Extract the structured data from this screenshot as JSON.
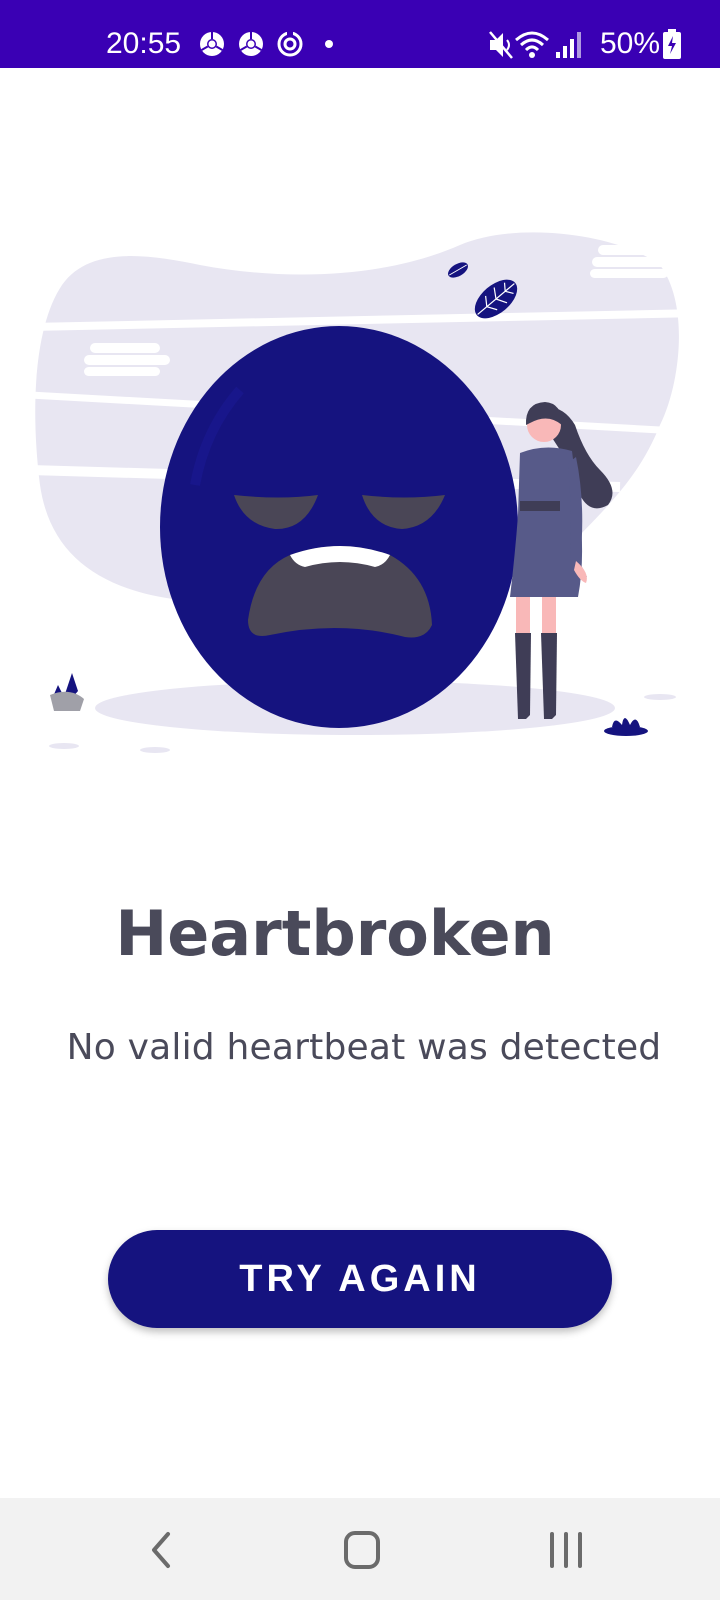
{
  "status_bar": {
    "time": "20:55",
    "battery": "50%",
    "background_color": "#3a00b4",
    "left_icons": [
      "chrome-icon",
      "chrome-icon",
      "sync-icon",
      "dot-icon"
    ],
    "right_icons": [
      "mute-icon",
      "wifi-icon",
      "signal-icon",
      "battery-charging-icon"
    ]
  },
  "illustration": {
    "icon": "heartbroken-illustration",
    "accent_color": "#15137f"
  },
  "main": {
    "title": "Heartbroken",
    "subtitle": "No valid heartbeat was detected",
    "button_label": "TRY AGAIN",
    "button_color": "#15137f",
    "text_color": "#4a4a5a"
  },
  "nav_bar": {
    "buttons": [
      "back-icon",
      "home-icon",
      "recents-icon"
    ]
  }
}
